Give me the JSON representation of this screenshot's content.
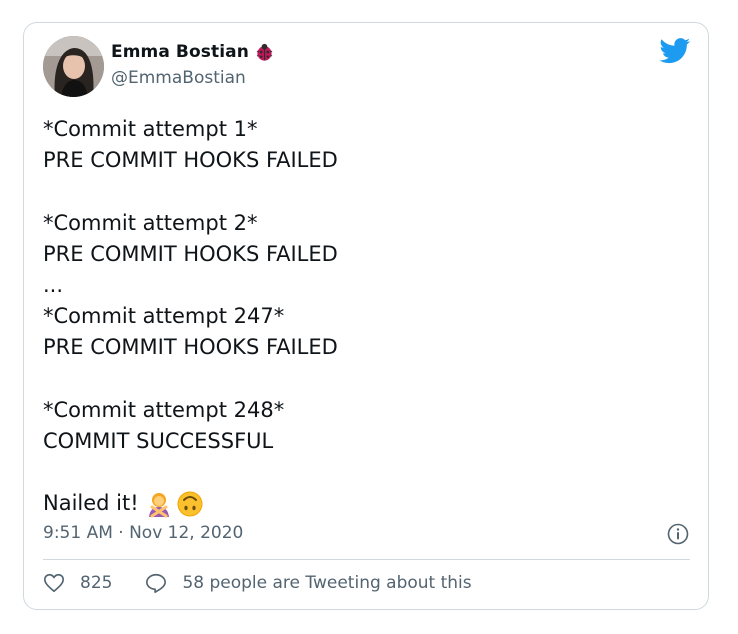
{
  "tweet": {
    "author_name": "Emma Bostian",
    "author_handle": "@EmmaBostian",
    "lines": [
      "*Commit attempt 1*",
      "PRE COMMIT HOOKS FAILED",
      "",
      "*Commit attempt 2*",
      "PRE COMMIT HOOKS FAILED",
      "...",
      "*Commit attempt 247*",
      "PRE COMMIT HOOKS FAILED",
      "",
      "*Commit attempt 248*",
      "COMMIT SUCCESSFUL",
      "",
      "Nailed it!"
    ],
    "emojis": [
      "person-gesturing-no",
      "upside-down-face"
    ],
    "timestamp": "9:51 AM · Nov 12, 2020",
    "likes": "825",
    "replies_text": "58 people are Tweeting about this"
  },
  "icons": {
    "badge": "ladybug-icon",
    "brand": "twitter-bird-icon",
    "info": "info-icon",
    "like": "heart-icon",
    "reply": "speech-bubble-icon"
  },
  "colors": {
    "brand": "#1d9bf0",
    "text": "#0f1419",
    "secondary": "#536471",
    "border": "#cfd9de"
  }
}
